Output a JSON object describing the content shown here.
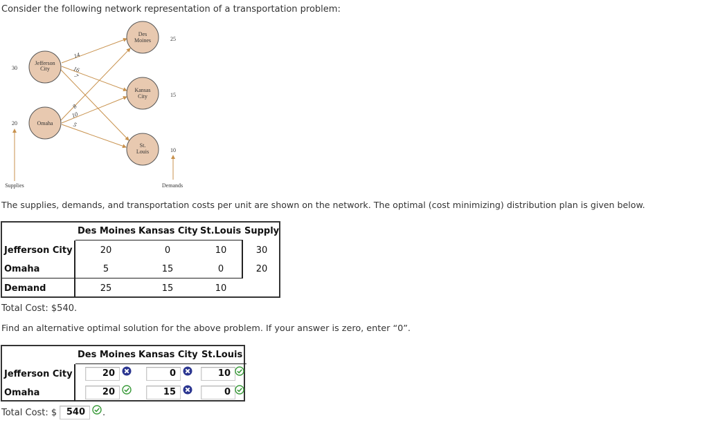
{
  "intro_text": "Consider the following network representation of a transportation problem:",
  "network": {
    "sources": [
      {
        "name_line1": "Jefferson",
        "name_line2": "City",
        "supply": "30"
      },
      {
        "name_line1": "Omaha",
        "name_line2": "",
        "supply": "20"
      }
    ],
    "destinations": [
      {
        "name_line1": "Des",
        "name_line2": "Moines",
        "demand": "25"
      },
      {
        "name_line1": "Kansas",
        "name_line2": "City",
        "demand": "15"
      },
      {
        "name_line1": "St.",
        "name_line2": "Louis",
        "demand": "10"
      }
    ],
    "costs": {
      "jefferson_des_moines": "14",
      "jefferson_kansas_city": "16",
      "jefferson_st_louis": "7",
      "omaha_des_moines": "8",
      "omaha_kansas_city": "10",
      "omaha_st_louis": "5"
    },
    "supplies_label": "Supplies",
    "demands_label": "Demands",
    "colors": {
      "node_fill": "#e8c9b0",
      "node_stroke": "#555555",
      "arrow": "#c8924e"
    }
  },
  "description": "The supplies, demands, and transportation costs per unit are shown on the network. The optimal (cost minimizing) distribution plan is given below.",
  "optimal_table": {
    "headers": [
      "Des Moines",
      "Kansas City",
      "St.Louis",
      "Supply"
    ],
    "rows": [
      {
        "label": "Jefferson City",
        "values": [
          "20",
          "0",
          "10"
        ],
        "supply": "30"
      },
      {
        "label": "Omaha",
        "values": [
          "5",
          "15",
          "0"
        ],
        "supply": "20"
      }
    ],
    "demand_row": {
      "label": "Demand",
      "values": [
        "25",
        "15",
        "10"
      ]
    }
  },
  "total_cost_text": "Total Cost: $540.",
  "instruction": "Find an alternative optimal solution for the above problem. If your answer is zero, enter “0”.",
  "answer_table": {
    "headers": [
      "Des Moines",
      "Kansas City",
      "St.Louis"
    ],
    "rows": [
      {
        "label": "Jefferson City",
        "inputs": [
          {
            "value": "20",
            "status": "incorrect"
          },
          {
            "value": "0",
            "status": "incorrect"
          },
          {
            "value": "10",
            "status": "correct"
          }
        ]
      },
      {
        "label": "Omaha",
        "inputs": [
          {
            "value": "20",
            "status": "correct"
          },
          {
            "value": "15",
            "status": "incorrect"
          },
          {
            "value": "0",
            "status": "correct"
          }
        ]
      }
    ]
  },
  "answer_total": {
    "prefix": "Total Cost: $",
    "value": "540",
    "status": "correct",
    "suffix": "."
  },
  "status_colors": {
    "correct": "#3a9a3a",
    "incorrect": "#2a3590"
  }
}
